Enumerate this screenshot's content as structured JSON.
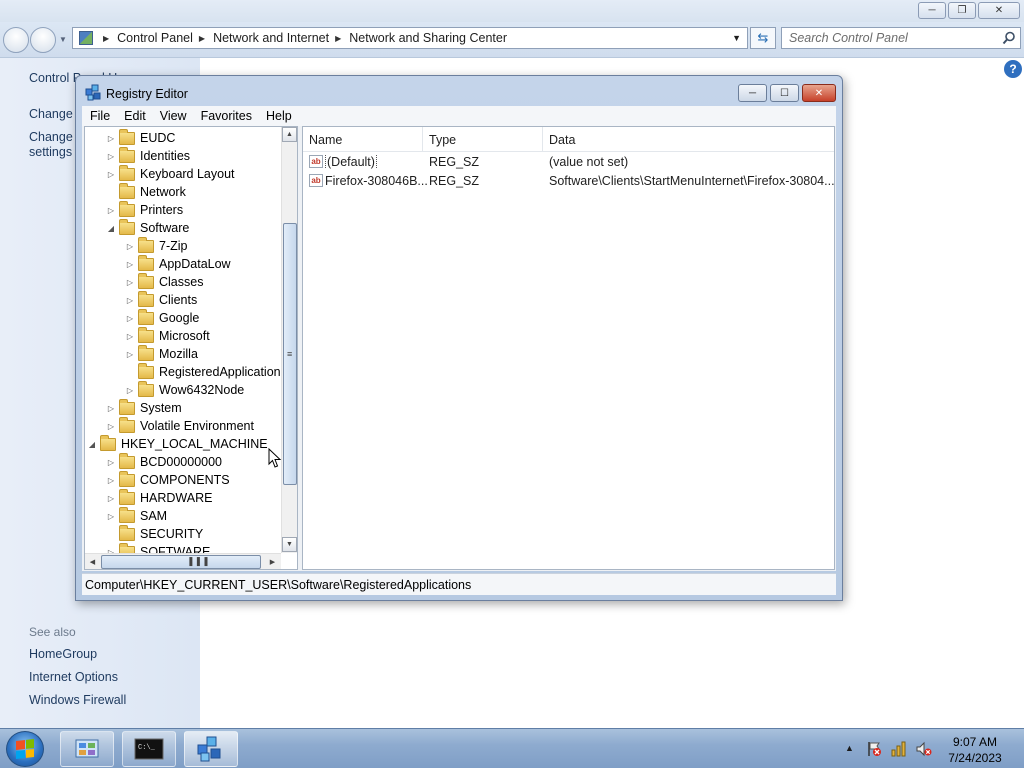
{
  "explorer": {
    "breadcrumb": [
      "Control Panel",
      "Network and Internet",
      "Network and Sharing Center"
    ],
    "search_placeholder": "Search Control Panel",
    "left_links": {
      "home": "Control Panel Home",
      "change1": "Change adapter settings",
      "change2_line1": "Change advanced sharing",
      "change2_line2": "settings"
    },
    "see_also": {
      "heading": "See also",
      "links": [
        "HomeGroup",
        "Internet Options",
        "Windows Firewall"
      ]
    },
    "help_glyph": "?"
  },
  "regedit": {
    "title": "Registry Editor",
    "menu": [
      "File",
      "Edit",
      "View",
      "Favorites",
      "Help"
    ],
    "tree": [
      {
        "label": "EUDC",
        "level": 1,
        "expander": "collapsed"
      },
      {
        "label": "Identities",
        "level": 1,
        "expander": "collapsed"
      },
      {
        "label": "Keyboard Layout",
        "level": 1,
        "expander": "collapsed"
      },
      {
        "label": "Network",
        "level": 1,
        "expander": "none"
      },
      {
        "label": "Printers",
        "level": 1,
        "expander": "collapsed"
      },
      {
        "label": "Software",
        "level": 1,
        "expander": "expanded"
      },
      {
        "label": "7-Zip",
        "level": 2,
        "expander": "collapsed"
      },
      {
        "label": "AppDataLow",
        "level": 2,
        "expander": "collapsed"
      },
      {
        "label": "Classes",
        "level": 2,
        "expander": "collapsed"
      },
      {
        "label": "Clients",
        "level": 2,
        "expander": "collapsed"
      },
      {
        "label": "Google",
        "level": 2,
        "expander": "collapsed"
      },
      {
        "label": "Microsoft",
        "level": 2,
        "expander": "collapsed"
      },
      {
        "label": "Mozilla",
        "level": 2,
        "expander": "collapsed"
      },
      {
        "label": "RegisteredApplications",
        "level": 2,
        "expander": "none",
        "selected": true
      },
      {
        "label": "Wow6432Node",
        "level": 2,
        "expander": "collapsed"
      },
      {
        "label": "System",
        "level": 1,
        "expander": "collapsed"
      },
      {
        "label": "Volatile Environment",
        "level": 1,
        "expander": "collapsed"
      },
      {
        "label": "HKEY_LOCAL_MACHINE",
        "level": 0,
        "expander": "expanded"
      },
      {
        "label": "BCD00000000",
        "level": 1,
        "expander": "collapsed"
      },
      {
        "label": "COMPONENTS",
        "level": 1,
        "expander": "collapsed"
      },
      {
        "label": "HARDWARE",
        "level": 1,
        "expander": "collapsed"
      },
      {
        "label": "SAM",
        "level": 1,
        "expander": "collapsed"
      },
      {
        "label": "SECURITY",
        "level": 1,
        "expander": "none"
      },
      {
        "label": "SOFTWARE",
        "level": 1,
        "expander": "collapsed"
      }
    ],
    "columns": {
      "name": "Name",
      "type": "Type",
      "data": "Data"
    },
    "values": [
      {
        "name": "(Default)",
        "type": "REG_SZ",
        "data": "(value not set)",
        "icon": "ab"
      },
      {
        "name": "Firefox-308046B...",
        "type": "REG_SZ",
        "data": "Software\\Clients\\StartMenuInternet\\Firefox-30804...",
        "icon": "ab"
      }
    ],
    "status_path": "Computer\\HKEY_CURRENT_USER\\Software\\RegisteredApplications"
  },
  "taskbar": {
    "time": "9:07 AM",
    "date": "7/24/2023",
    "cmd_prompt_glyph": "C:\\_"
  },
  "colors": {
    "accent": "#2f6fbf",
    "link": "#1e3a5f",
    "taskbar": "#8eabcf"
  }
}
